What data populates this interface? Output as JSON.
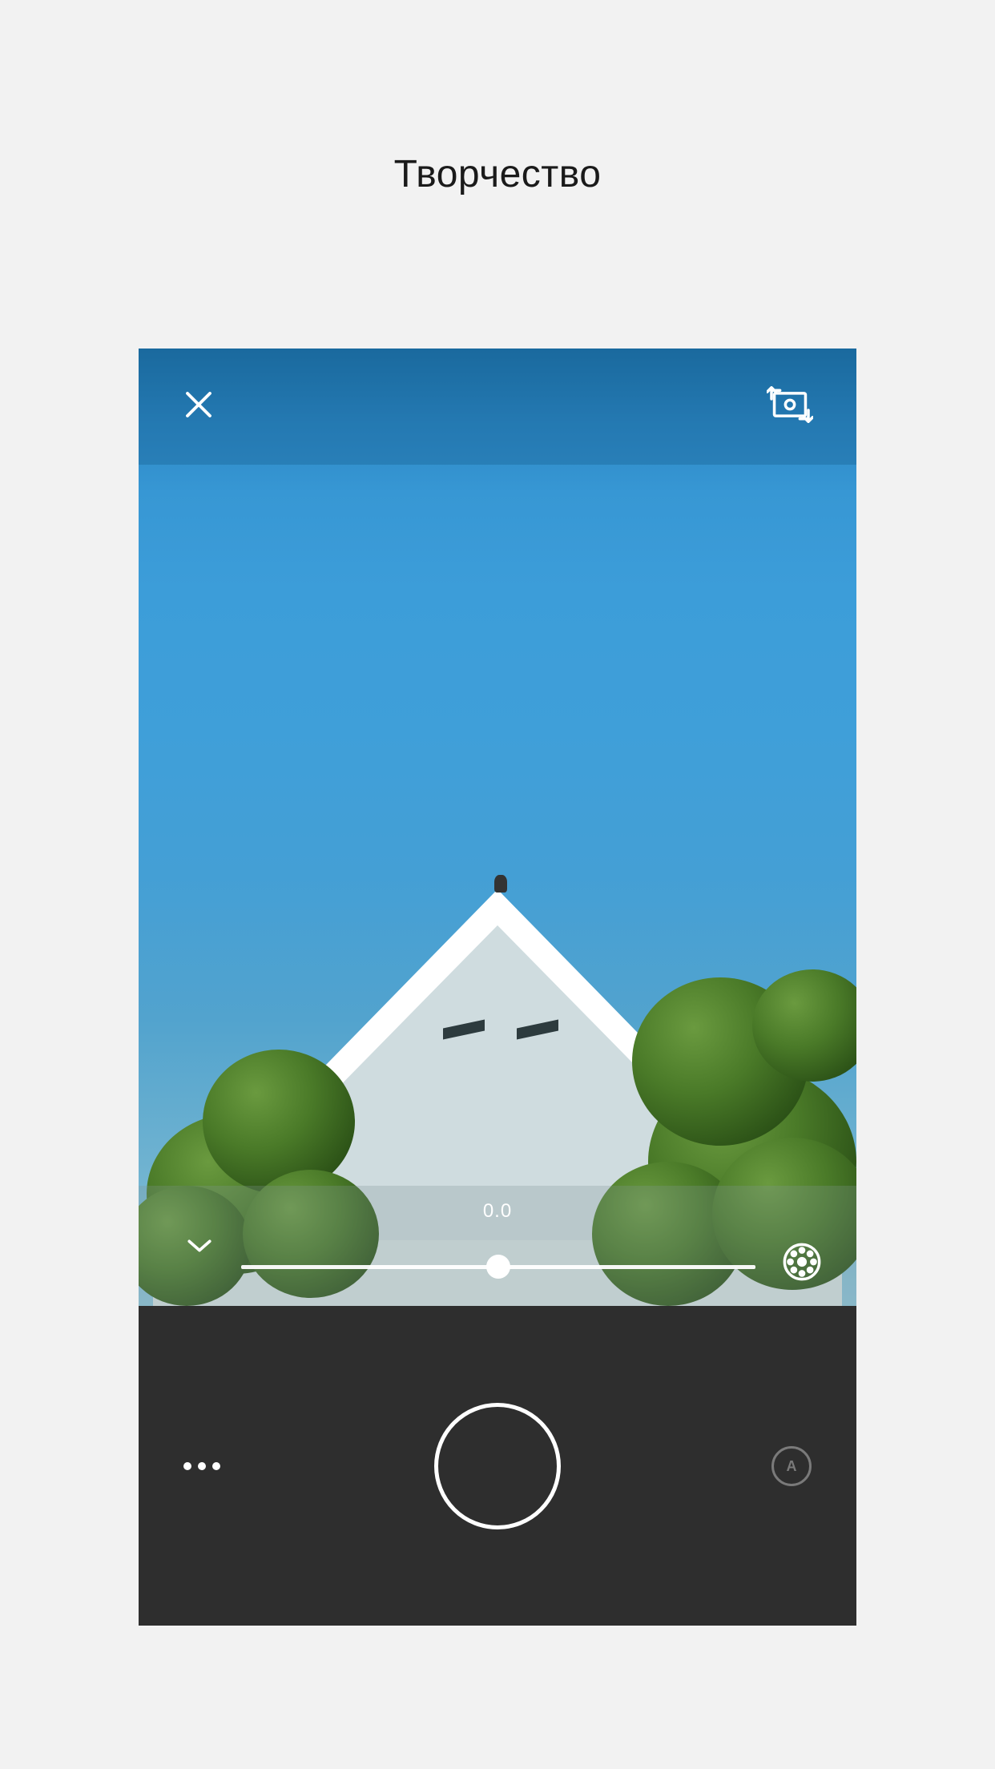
{
  "page": {
    "title": "Творчество"
  },
  "topbar": {
    "close_icon": "close-icon",
    "switch_icon": "switch-camera-icon"
  },
  "slider": {
    "value_label": "0.0",
    "value": 0.0,
    "min": -10,
    "max": 10,
    "collapse_icon": "chevron-down-icon",
    "filter_icon": "filter-wheel-icon"
  },
  "bottombar": {
    "more_icon": "more-icon",
    "shutter": "shutter-button",
    "mode_label": "A"
  },
  "colors": {
    "page_bg": "#f2f2f2",
    "bottom_bar_bg": "#2e2e2e",
    "topbar_overlay": "rgba(23,98,148,0.38)",
    "accent_white": "#ffffff"
  }
}
